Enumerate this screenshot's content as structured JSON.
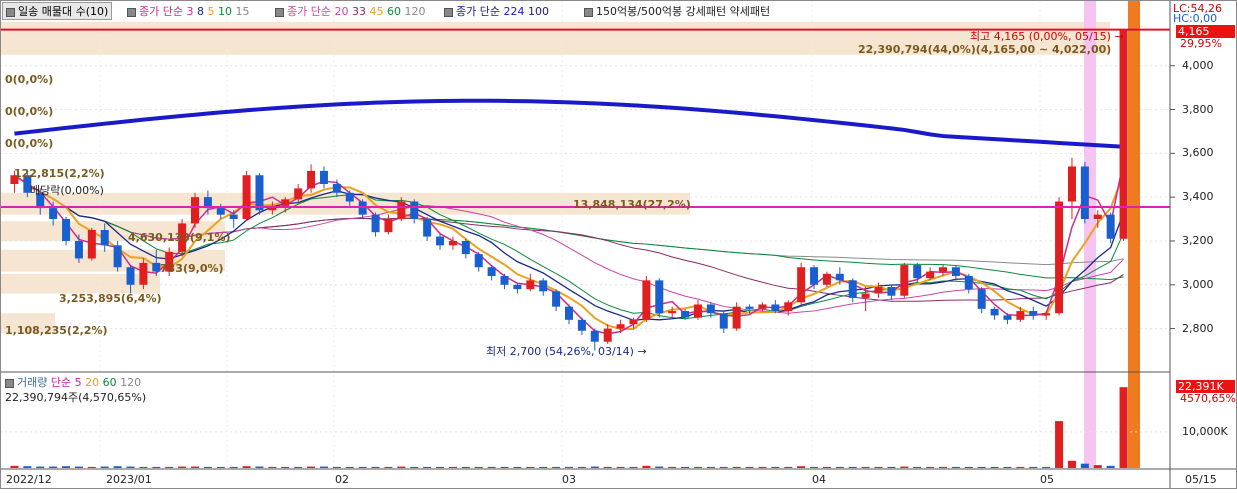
{
  "colors": {
    "up": "#e02020",
    "down": "#1a5fd0",
    "ma3": "#d22a8c",
    "ma8": "#1a2a8a",
    "ma5": "#e8a320",
    "ma20": "#cc44aa",
    "ma33": "#8a8a8a",
    "ma224": "#1a1ac8",
    "hline_red": "#e0102a",
    "hline_magenta": "#e020b0",
    "band": "#f5e2cc"
  },
  "legend_price": {
    "main": "일송 매물대 수(10)",
    "g1_label": "종가 단순",
    "g1": [
      "3",
      "8",
      "5",
      "10",
      "15"
    ],
    "g2_label": "종가 단순",
    "g2": [
      "20",
      "33",
      "45",
      "60",
      "120"
    ],
    "g3_label": "종가 단순",
    "g3": [
      "224",
      "100"
    ],
    "pattern": "150억봉/500억봉 강세패턴  약세패턴"
  },
  "legend_volume": {
    "label": "거래량",
    "sub": "단순",
    "periods": [
      "5",
      "20",
      "60",
      "120"
    ],
    "summary": "22,390,794주(4,570,65%)"
  },
  "annotations": {
    "high": "최고 4,165 (0,00%, 05/15)",
    "high_volume": "22,390,794(44,0%)(4,165,00 ~ 4,022,00)",
    "mid_volume": "13,848,134(27,2%)",
    "low": "최저 2,700 (54,26%, 03/14)",
    "zero1": "0(0,0%)",
    "zero2": "0(0,0%)",
    "zero3": "0(0,0%)",
    "v1": "122,815(2,2%)",
    "v1b": "배당락(0,00%)",
    "v2": "4,630,133(9,1%)",
    "v3": "733(9,0%)",
    "v4": "3,253,895(6,4%)",
    "v5": "1,108,235(2,2%)"
  },
  "right_panel": {
    "lc": "LC:54,26",
    "hc": "HC:0,00",
    "last_price": "4,165",
    "pct": "29,95%",
    "vol_last": "22,391K",
    "vol_pct": "4570,65%"
  },
  "chart_data": {
    "type": "candlestick",
    "price_ylim": [
      2620,
      4300
    ],
    "price_ticks": [
      "4,000",
      "3,800",
      "3,600",
      "3,400",
      "3,200",
      "3,000",
      "2,800"
    ],
    "volume_ticks": [
      "10,000K"
    ],
    "x_ticks": [
      "2022/12",
      "2023/01",
      "02",
      "03",
      "04",
      "05",
      "05/15"
    ],
    "hlines": [
      4165,
      3355
    ],
    "candles": [
      [
        3460,
        3520,
        3420,
        3500
      ],
      [
        3500,
        3510,
        3400,
        3420
      ],
      [
        3420,
        3440,
        3320,
        3350
      ],
      [
        3350,
        3380,
        3270,
        3300
      ],
      [
        3300,
        3310,
        3180,
        3200
      ],
      [
        3200,
        3230,
        3100,
        3120
      ],
      [
        3120,
        3260,
        3110,
        3250
      ],
      [
        3250,
        3280,
        3150,
        3180
      ],
      [
        3180,
        3200,
        3060,
        3080
      ],
      [
        3080,
        3090,
        2960,
        3000
      ],
      [
        3000,
        3120,
        2980,
        3100
      ],
      [
        3100,
        3160,
        3040,
        3060
      ],
      [
        3060,
        3170,
        3040,
        3150
      ],
      [
        3150,
        3300,
        3130,
        3280
      ],
      [
        3280,
        3420,
        3260,
        3400
      ],
      [
        3400,
        3430,
        3320,
        3350
      ],
      [
        3350,
        3370,
        3300,
        3320
      ],
      [
        3320,
        3340,
        3260,
        3300
      ],
      [
        3300,
        3520,
        3290,
        3500
      ],
      [
        3500,
        3510,
        3320,
        3340
      ],
      [
        3340,
        3380,
        3320,
        3360
      ],
      [
        3360,
        3400,
        3330,
        3390
      ],
      [
        3390,
        3460,
        3370,
        3440
      ],
      [
        3440,
        3550,
        3420,
        3520
      ],
      [
        3520,
        3540,
        3440,
        3460
      ],
      [
        3460,
        3480,
        3400,
        3420
      ],
      [
        3420,
        3430,
        3360,
        3380
      ],
      [
        3380,
        3390,
        3300,
        3320
      ],
      [
        3320,
        3330,
        3220,
        3240
      ],
      [
        3240,
        3320,
        3230,
        3300
      ],
      [
        3300,
        3400,
        3290,
        3380
      ],
      [
        3380,
        3390,
        3280,
        3300
      ],
      [
        3300,
        3310,
        3200,
        3220
      ],
      [
        3220,
        3230,
        3160,
        3180
      ],
      [
        3180,
        3220,
        3160,
        3200
      ],
      [
        3200,
        3210,
        3120,
        3140
      ],
      [
        3140,
        3150,
        3060,
        3080
      ],
      [
        3080,
        3090,
        3020,
        3040
      ],
      [
        3040,
        3050,
        2980,
        3000
      ],
      [
        3000,
        3010,
        2960,
        2980
      ],
      [
        2980,
        3050,
        2970,
        3020
      ],
      [
        3020,
        3030,
        2950,
        2970
      ],
      [
        2970,
        2980,
        2880,
        2900
      ],
      [
        2900,
        2910,
        2820,
        2840
      ],
      [
        2840,
        2850,
        2770,
        2790
      ],
      [
        2790,
        2800,
        2700,
        2740
      ],
      [
        2740,
        2820,
        2730,
        2800
      ],
      [
        2800,
        2840,
        2780,
        2820
      ],
      [
        2820,
        2850,
        2800,
        2840
      ],
      [
        2840,
        3040,
        2830,
        3020
      ],
      [
        3020,
        3030,
        2850,
        2870
      ],
      [
        2870,
        2900,
        2850,
        2880
      ],
      [
        2880,
        2890,
        2840,
        2850
      ],
      [
        2850,
        2930,
        2840,
        2910
      ],
      [
        2910,
        2920,
        2850,
        2870
      ],
      [
        2870,
        2880,
        2780,
        2800
      ],
      [
        2800,
        2920,
        2790,
        2900
      ],
      [
        2900,
        2910,
        2870,
        2890
      ],
      [
        2890,
        2920,
        2880,
        2910
      ],
      [
        2910,
        2930,
        2870,
        2880
      ],
      [
        2880,
        2930,
        2860,
        2920
      ],
      [
        2920,
        3100,
        2910,
        3080
      ],
      [
        3080,
        3090,
        2980,
        3000
      ],
      [
        3000,
        3060,
        2990,
        3050
      ],
      [
        3050,
        3080,
        3000,
        3020
      ],
      [
        3020,
        3030,
        2920,
        2940
      ],
      [
        2940,
        2990,
        2880,
        2960
      ],
      [
        2960,
        3010,
        2940,
        2990
      ],
      [
        2990,
        3000,
        2930,
        2950
      ],
      [
        2950,
        3100,
        2940,
        3090
      ],
      [
        3090,
        3100,
        3010,
        3030
      ],
      [
        3030,
        3080,
        3020,
        3060
      ],
      [
        3060,
        3090,
        3040,
        3080
      ],
      [
        3080,
        3090,
        3020,
        3040
      ],
      [
        3040,
        3050,
        2960,
        2980
      ],
      [
        2980,
        2990,
        2870,
        2890
      ],
      [
        2890,
        2900,
        2840,
        2860
      ],
      [
        2860,
        2870,
        2820,
        2840
      ],
      [
        2840,
        2900,
        2830,
        2880
      ],
      [
        2880,
        2900,
        2840,
        2860
      ],
      [
        2860,
        2880,
        2840,
        2870
      ],
      [
        2870,
        3400,
        2860,
        3380
      ],
      [
        3380,
        3580,
        3300,
        3540
      ],
      [
        3540,
        3560,
        3280,
        3300
      ],
      [
        3300,
        3340,
        3260,
        3320
      ],
      [
        3320,
        3330,
        3190,
        3210
      ],
      [
        3210,
        4165,
        3200,
        4165
      ]
    ],
    "volume": [
      0.6,
      0.5,
      0.4,
      0.4,
      0.5,
      0.4,
      0.3,
      0.4,
      0.5,
      0.4,
      0.3,
      0.3,
      0.3,
      0.4,
      0.4,
      0.3,
      0.3,
      0.3,
      0.5,
      0.4,
      0.3,
      0.3,
      0.3,
      0.4,
      0.4,
      0.3,
      0.3,
      0.3,
      0.3,
      0.3,
      0.4,
      0.3,
      0.3,
      0.3,
      0.3,
      0.3,
      0.3,
      0.3,
      0.3,
      0.3,
      0.3,
      0.3,
      0.3,
      0.3,
      0.3,
      0.4,
      0.3,
      0.3,
      0.3,
      0.6,
      0.4,
      0.3,
      0.3,
      0.3,
      0.3,
      0.3,
      0.3,
      0.3,
      0.3,
      0.3,
      0.3,
      0.5,
      0.3,
      0.3,
      0.3,
      0.3,
      0.3,
      0.3,
      0.3,
      0.4,
      0.3,
      0.3,
      0.3,
      0.3,
      0.3,
      0.3,
      0.3,
      0.3,
      0.3,
      0.3,
      0.3,
      13.0,
      2.0,
      1.2,
      0.8,
      0.6,
      22.4
    ]
  }
}
